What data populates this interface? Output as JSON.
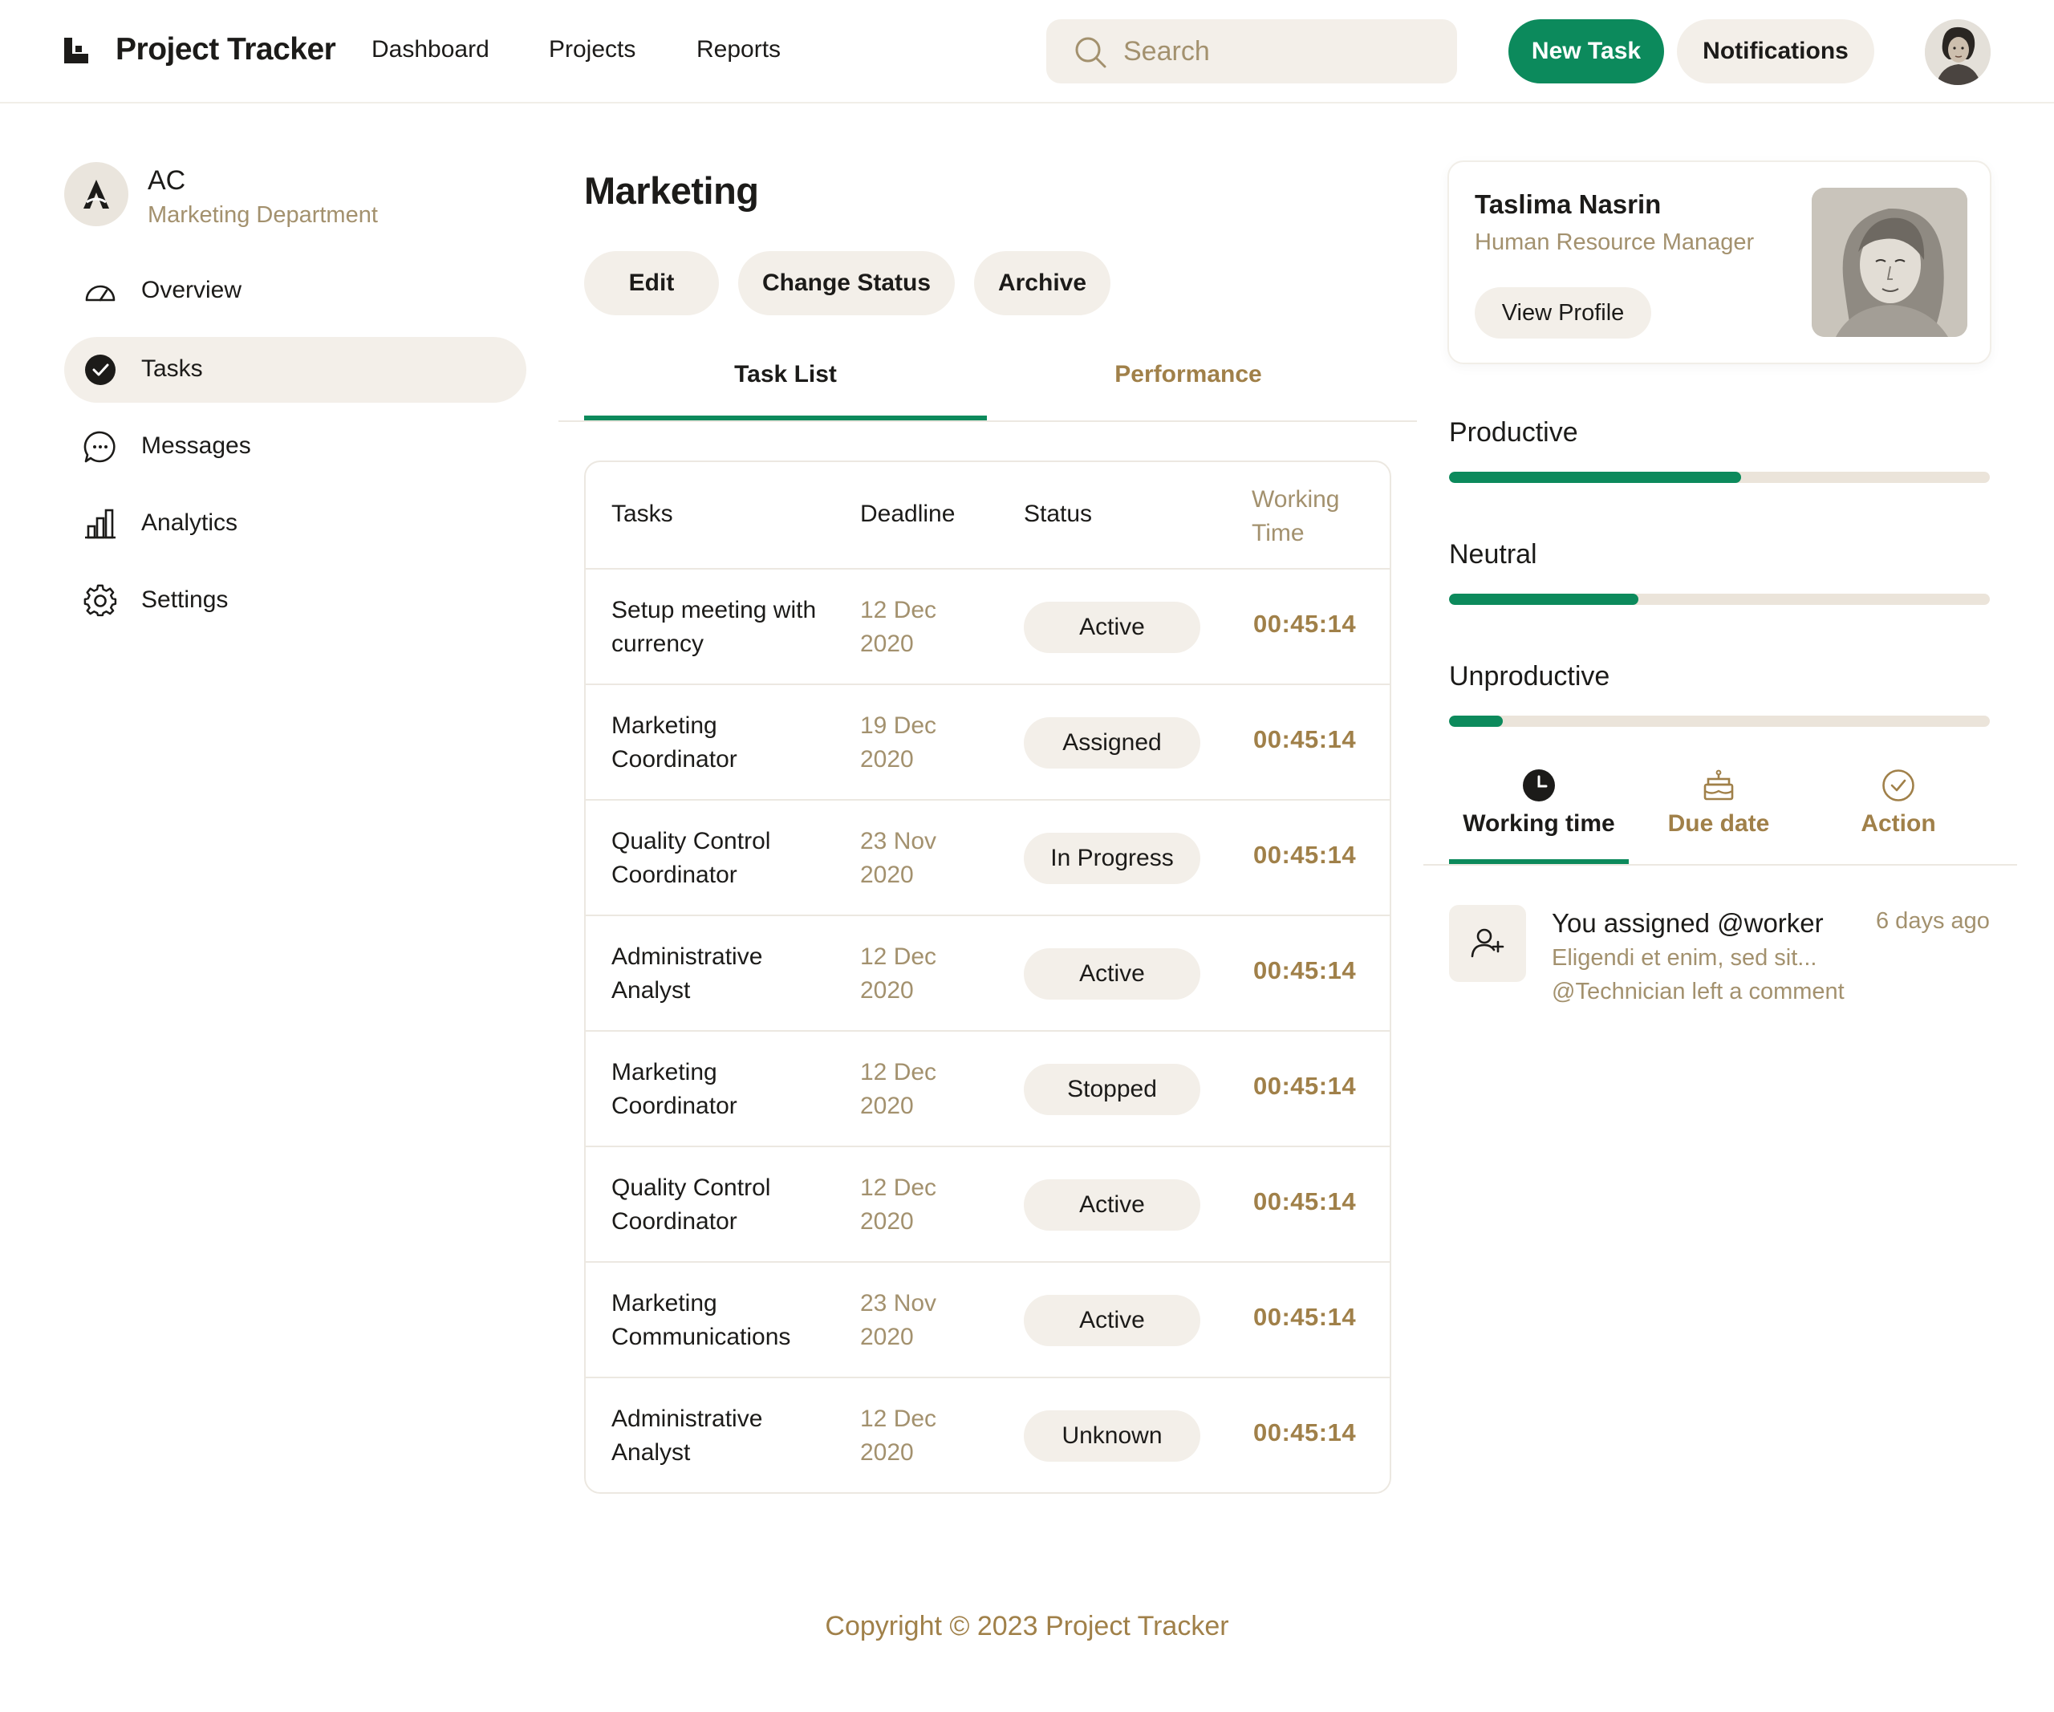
{
  "header": {
    "brand": "Project Tracker",
    "nav": [
      "Dashboard",
      "Projects",
      "Reports"
    ],
    "search_placeholder": "Search",
    "new_task_label": "New Task",
    "notifications_label": "Notifications"
  },
  "sidebar": {
    "org_name": "AC",
    "org_department": "Marketing Department",
    "items": [
      {
        "label": "Overview",
        "icon": "gauge-icon"
      },
      {
        "label": "Tasks",
        "icon": "check-circle-icon",
        "active": true
      },
      {
        "label": "Messages",
        "icon": "chat-icon"
      },
      {
        "label": "Analytics",
        "icon": "bar-chart-icon"
      },
      {
        "label": "Settings",
        "icon": "gear-icon"
      }
    ]
  },
  "main": {
    "title": "Marketing",
    "actions": [
      "Edit",
      "Change Status",
      "Archive"
    ],
    "tabs": [
      "Task List",
      "Performance"
    ],
    "table": {
      "headers": [
        "Tasks",
        "Deadline",
        "Status",
        "Working Time"
      ],
      "rows": [
        {
          "task": "Setup meeting with currency",
          "deadline": "12 Dec 2020",
          "status": "Active",
          "time": "00:45:14"
        },
        {
          "task": "Marketing Coordinator",
          "deadline": "19 Dec 2020",
          "status": "Assigned",
          "time": "00:45:14"
        },
        {
          "task": "Quality Control Coordinator",
          "deadline": "23 Nov 2020",
          "status": "In Progress",
          "time": "00:45:14"
        },
        {
          "task": "Administrative Analyst",
          "deadline": "12 Dec 2020",
          "status": "Active",
          "time": "00:45:14"
        },
        {
          "task": "Marketing Coordinator",
          "deadline": "12 Dec 2020",
          "status": "Stopped",
          "time": "00:45:14"
        },
        {
          "task": "Quality Control Coordinator",
          "deadline": "12 Dec 2020",
          "status": "Active",
          "time": "00:45:14"
        },
        {
          "task": "Marketing Communications",
          "deadline": "23 Nov 2020",
          "status": "Active",
          "time": "00:45:14"
        },
        {
          "task": "Administrative Analyst",
          "deadline": "12 Dec 2020",
          "status": "Unknown",
          "time": "00:45:14"
        }
      ]
    }
  },
  "profile": {
    "name": "Taslima Nasrin",
    "role": "Human Resource Manager",
    "view_profile_label": "View Profile"
  },
  "productivity": [
    {
      "label": "Productive",
      "fraction": 0.54
    },
    {
      "label": "Neutral",
      "fraction": 0.35
    },
    {
      "label": "Unproductive",
      "fraction": 0.1
    }
  ],
  "right_tabs": [
    "Working time",
    "Due date",
    "Action"
  ],
  "activity": {
    "title": "You assigned @worker",
    "line1": "Eligendi et enim, sed sit...",
    "line2": "@Technician left a comment",
    "time": "6 days ago"
  },
  "footer": "Copyright © 2023 Project Tracker",
  "colors": {
    "accent": "#0c8a5c",
    "muted_text": "#a3916e",
    "time_text": "#a08049",
    "pill_bg": "#f3efe9"
  }
}
